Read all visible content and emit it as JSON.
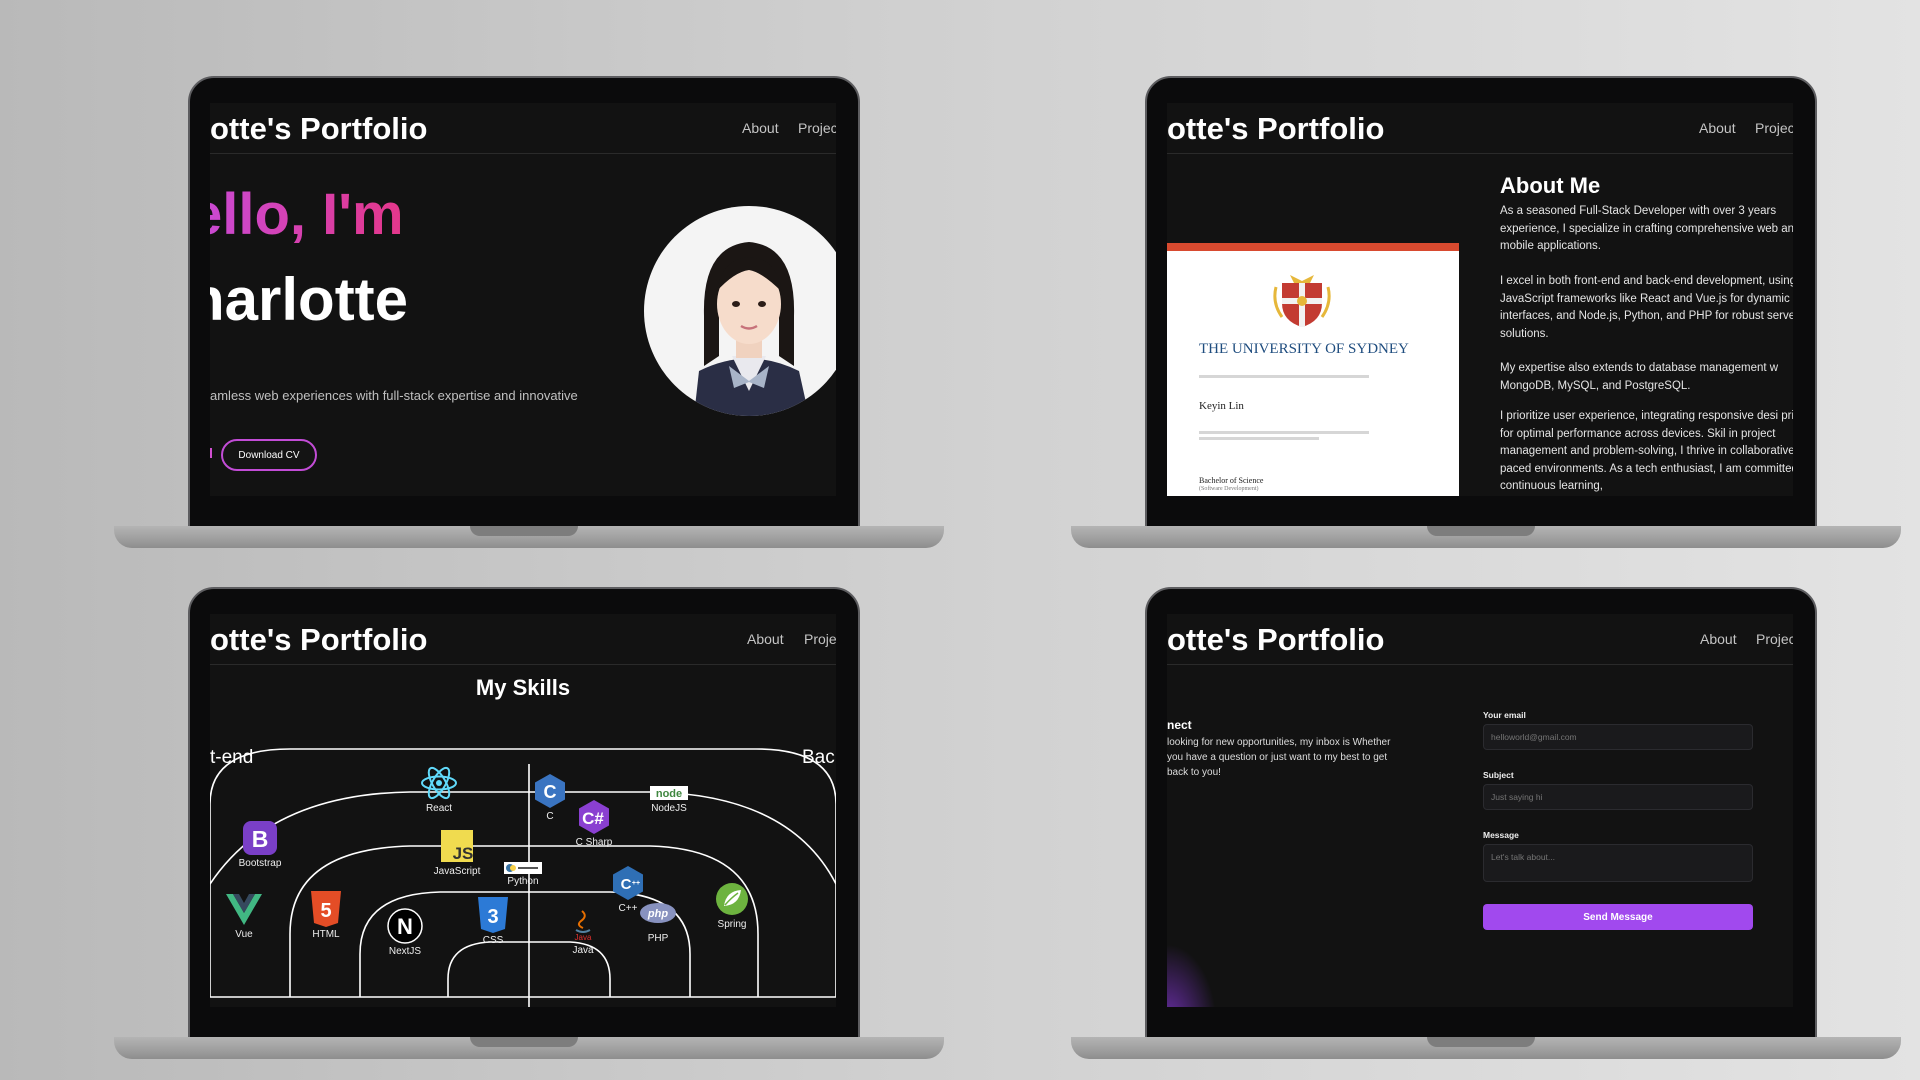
{
  "nav": {
    "brand": "otte's Portfolio",
    "about": "About",
    "projects_1": "Projec",
    "projects_2": "Projec",
    "projects_3": "Proje",
    "projects_4": "Projec"
  },
  "hero": {
    "greeting": "ello, I'm",
    "name": "harlotte",
    "tagline": "amless web experiences with full-stack expertise and innovative",
    "cv_button": "Download CV"
  },
  "about": {
    "heading": "About Me",
    "paragraphs": [
      "As a seasoned Full-Stack Developer with over 3 years experience, I specialize in crafting comprehensive web and mobile applications.",
      "I excel in both front-end and back-end development, using JavaScript frameworks like React and Vue.js for dynamic interfaces, and Node.js, Python, and PHP for robust server-side solutions.",
      "My expertise also extends to database management w MongoDB, MySQL, and PostgreSQL.",
      "I prioritize user experience, integrating responsive desi principles for optimal performance across devices. Skil in project management and problem-solving, I thrive in collaborative, fast-paced environments. As a tech enthusiast, I am committed to continuous learning,"
    ],
    "certificate": {
      "university": "THE UNIVERSITY OF SYDNEY",
      "recipient": "Keyin Lin",
      "degree": "Bachelor of Science",
      "major": "(Software Development)"
    }
  },
  "skills": {
    "heading": "My Skills",
    "left_label": "t-end",
    "right_label": "Bac",
    "items": {
      "react": "React",
      "c": "C",
      "csharp": "C Sharp",
      "nodejs": "NodeJS",
      "bootstrap": "Bootstrap",
      "javascript": "JavaScript",
      "python": "Python",
      "cpp": "C++",
      "vue": "Vue",
      "html": "HTML",
      "nextjs": "NextJS",
      "css": "CSS",
      "java": "Java",
      "php": "PHP",
      "spring": "Spring"
    }
  },
  "contact": {
    "title": "nect",
    "text": "looking for new opportunities, my inbox is Whether you have a question or just want to my best to get back to you!",
    "email_label": "Your email",
    "email_placeholder": "helloworld@gmail.com",
    "subject_label": "Subject",
    "subject_placeholder": "Just saying hi",
    "message_label": "Message",
    "message_placeholder": "Let's talk about...",
    "send_button": "Send Message"
  },
  "colors": {
    "accent_purple": "#a149ee",
    "hero_gradient_start": "#c84bd8",
    "hero_gradient_end": "#e4378a",
    "screen_bg": "#121212"
  }
}
